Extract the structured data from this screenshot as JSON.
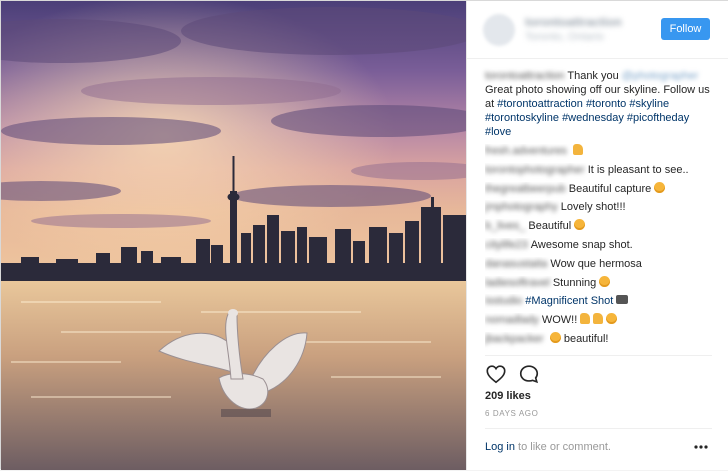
{
  "post": {
    "account": {
      "username": "torontoattraction",
      "location": "Toronto, Ontario",
      "follow_label": "Follow"
    },
    "caption": {
      "username": "torontoattraction",
      "text_1": "Thank you",
      "mention": "@photographer",
      "text_2": "Great photo showing off our skyline. Follow us at",
      "hashtags": [
        "#torontoattraction",
        "#toronto",
        "#skyline",
        "#torontoskyline",
        "#wednesday",
        "#picoftheday",
        "#love"
      ]
    },
    "comments": [
      {
        "user": "fresh.adventures",
        "text": "",
        "emoji": "thumbs-up"
      },
      {
        "user": "torontophotographer",
        "text": "It is pleasant to see..",
        "emoji": ""
      },
      {
        "user": "thegreatbeerpub",
        "text": "Beautiful capture",
        "emoji": "heart-eyes"
      },
      {
        "user": "jmphotography",
        "text": "Lovely shot!!!",
        "emoji": ""
      },
      {
        "user": "b_lives_",
        "text": "Beautiful",
        "emoji": "heart-eyes"
      },
      {
        "user": "citylife23",
        "text": "Awesome snap shot.",
        "emoji": ""
      },
      {
        "user": "danasustaita",
        "text": "Wow que hermosa",
        "emoji": ""
      },
      {
        "user": "ladiesoftravel",
        "text": "Stunning",
        "emoji": "heart-eyes"
      },
      {
        "user": "isstudio",
        "text": "#Magnificent Shot",
        "emoji": "camera"
      },
      {
        "user": "nomadlady",
        "text": "WOW!!",
        "emoji": "thumbs-ok-heart"
      },
      {
        "user": "jbackpacker",
        "text": "beautiful!",
        "emoji": "heart-eyes"
      }
    ],
    "actions": {
      "like_icon": "heart-icon",
      "comment_icon": "comment-bubble-icon"
    },
    "likes_label": "209 likes",
    "timestamp": "6 DAYS AGO",
    "login": {
      "link_label": "Log in",
      "suffix": "to like or comment."
    },
    "more_icon": "ellipsis-icon"
  },
  "colors": {
    "accent": "#3897f0",
    "hashtag": "#003569",
    "meta_text": "#999999"
  }
}
